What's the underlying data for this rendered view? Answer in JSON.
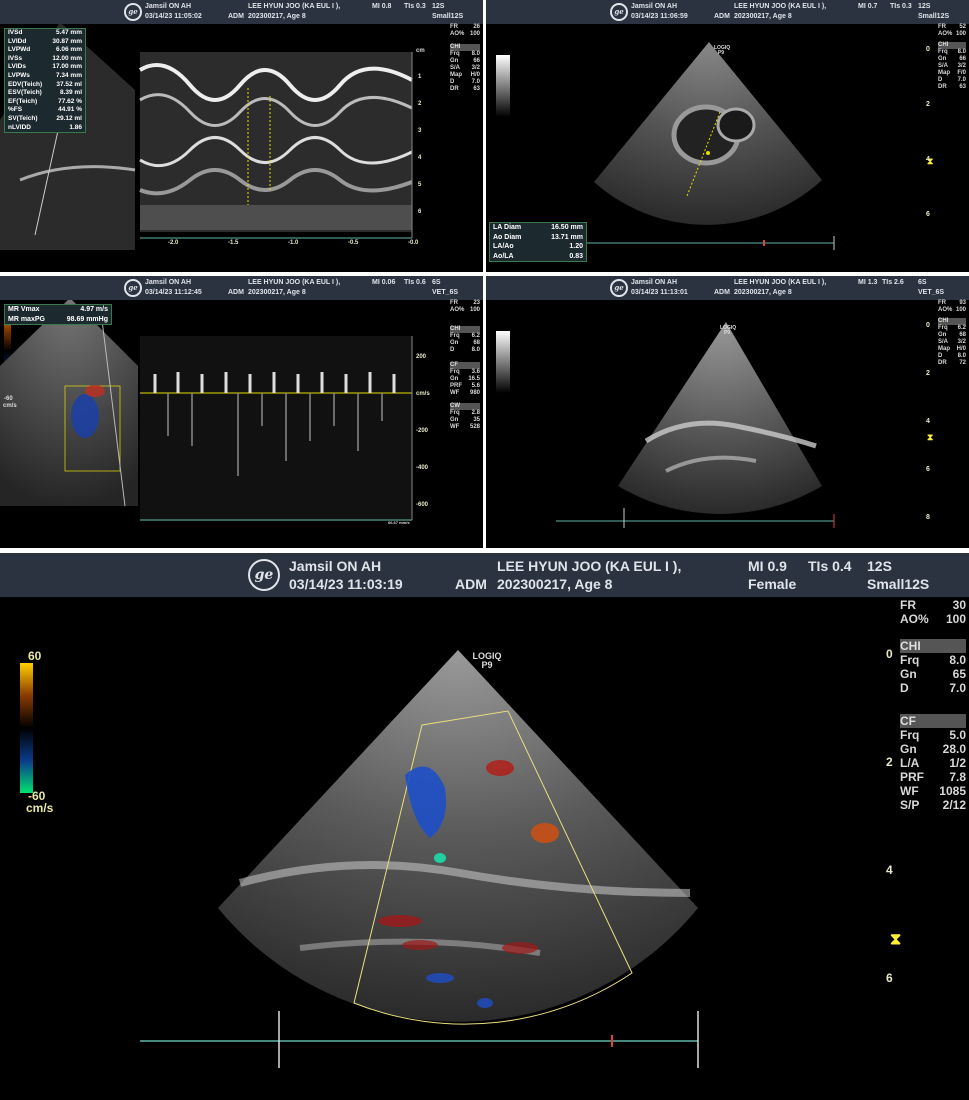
{
  "panel_tl": {
    "header": {
      "site": "Jamsil ON AH",
      "datetime": "03/14/23 11:05:02",
      "adm": "ADM",
      "patient": "LEE HYUN JOO (KA EUL I ),",
      "id_age": "202300217, Age 8",
      "mi": "MI 0.8",
      "tis": "TIs 0.3",
      "probe": "12S",
      "preset": "Small12S"
    },
    "side": [
      {
        "k": "FR",
        "v": "26"
      },
      {
        "k": "AO%",
        "v": "100"
      }
    ],
    "chi_title": "CHI",
    "chi": [
      {
        "k": "Frq",
        "v": "8.0"
      },
      {
        "k": "Gn",
        "v": "66"
      },
      {
        "k": "S/A",
        "v": "3/2"
      },
      {
        "k": "Map",
        "v": "H/0"
      },
      {
        "k": "D",
        "v": "7.0"
      },
      {
        "k": "DR",
        "v": "63"
      }
    ],
    "meas": [
      {
        "k": "IVSd",
        "v": "5.47 mm"
      },
      {
        "k": "LVIDd",
        "v": "30.87 mm"
      },
      {
        "k": "LVPWd",
        "v": "6.06 mm"
      },
      {
        "k": "IVSs",
        "v": "12.00 mm"
      },
      {
        "k": "LVIDs",
        "v": "17.00 mm"
      },
      {
        "k": "LVPWs",
        "v": "7.34 mm"
      },
      {
        "k": "EDV(Teich)",
        "v": "37.52 ml"
      },
      {
        "k": "ESV(Teich)",
        "v": "8.39 ml"
      },
      {
        "k": "EF(Teich)",
        "v": "77.62 %"
      },
      {
        "k": "%FS",
        "v": "44.91 %"
      },
      {
        "k": "SV(Teich)",
        "v": "29.12 ml"
      },
      {
        "k": "nLVIDD",
        "v": "1.86"
      }
    ],
    "depth_unit": "cm",
    "depth_ticks": [
      "1",
      "2",
      "3",
      "4",
      "5",
      "6"
    ],
    "time_ticks": [
      "-2.0",
      "-1.5",
      "-1.0",
      "-0.5",
      "-0.0"
    ]
  },
  "panel_tr": {
    "header": {
      "site": "Jamsil ON AH",
      "datetime": "03/14/23 11:06:59",
      "adm": "ADM",
      "patient": "LEE HYUN JOO (KA EUL I ),",
      "id_age": "202300217, Age 8",
      "mi": "MI 0.7",
      "tis": "TIs 0.3",
      "probe": "12S",
      "preset": "Small12S"
    },
    "side": [
      {
        "k": "FR",
        "v": "52"
      },
      {
        "k": "AO%",
        "v": "100"
      }
    ],
    "chi_title": "CHI",
    "chi": [
      {
        "k": "Frq",
        "v": "8.0"
      },
      {
        "k": "Gn",
        "v": "66"
      },
      {
        "k": "S/A",
        "v": "3/2"
      },
      {
        "k": "Map",
        "v": "F/0"
      },
      {
        "k": "D",
        "v": "7.0"
      },
      {
        "k": "DR",
        "v": "63"
      }
    ],
    "logo_text": "LOGIQ P9",
    "meas": [
      {
        "k": "LA Diam",
        "v": "16.50 mm"
      },
      {
        "k": "Ao Diam",
        "v": "13.71 mm"
      },
      {
        "k": "LA/Ao",
        "v": "1.20"
      },
      {
        "k": "Ao/LA",
        "v": "0.83"
      }
    ],
    "depth_ticks": [
      "0",
      "2",
      "4",
      "6"
    ]
  },
  "panel_ml": {
    "header": {
      "site": "Jamsil ON AH",
      "datetime": "03/14/23 11:12:45",
      "adm": "ADM",
      "patient": "LEE HYUN JOO (KA EUL I ),",
      "id_age": "202300217, Age 8",
      "mi": "MI 0.06",
      "tis": "TIs 0.6",
      "probe": "6S",
      "preset": "VET_6S"
    },
    "side": [
      {
        "k": "FR",
        "v": "23"
      },
      {
        "k": "AO%",
        "v": "100"
      }
    ],
    "chi_title": "CHI",
    "chi": [
      {
        "k": "Frq",
        "v": "6.2"
      },
      {
        "k": "Gn",
        "v": "68"
      },
      {
        "k": "D",
        "v": "8.0"
      }
    ],
    "cf_title": "CF",
    "cf": [
      {
        "k": "Frq",
        "v": "3.6"
      },
      {
        "k": "Gn",
        "v": "16.5"
      },
      {
        "k": "PRF",
        "v": "5.6"
      },
      {
        "k": "WF",
        "v": "980"
      }
    ],
    "cw_title": "CW",
    "cw": [
      {
        "k": "Frq",
        "v": "2.8"
      },
      {
        "k": "Gn",
        "v": "35"
      },
      {
        "k": "WF",
        "v": "528"
      }
    ],
    "meas": [
      {
        "k": "MR Vmax",
        "v": "4.97 m/s"
      },
      {
        "k": "MR maxPG",
        "v": "98.69 mmHg"
      }
    ],
    "scale_bottom": "-60",
    "scale_unit": "cm/s",
    "vel_ticks": [
      "200",
      "cm/s",
      "-200",
      "-400",
      "-600"
    ],
    "sweep_label": "66.67 mm/s"
  },
  "panel_mr": {
    "header": {
      "site": "Jamsil ON AH",
      "datetime": "03/14/23 11:13:01",
      "adm": "ADM",
      "patient": "LEE HYUN JOO (KA EUL I ),",
      "id_age": "202300217, Age 8",
      "mi": "MI 1.3",
      "tis": "TIs 2.6",
      "probe": "6S",
      "preset": "VET_6S"
    },
    "side": [
      {
        "k": "FR",
        "v": "93"
      },
      {
        "k": "AO%",
        "v": "100"
      }
    ],
    "chi_title": "CHI",
    "chi": [
      {
        "k": "Frq",
        "v": "6.2"
      },
      {
        "k": "Gn",
        "v": "68"
      },
      {
        "k": "S/A",
        "v": "3/2"
      },
      {
        "k": "Map",
        "v": "H/0"
      },
      {
        "k": "D",
        "v": "8.0"
      },
      {
        "k": "DR",
        "v": "72"
      }
    ],
    "logo_text": "LOGIQ P9",
    "depth_ticks": [
      "0",
      "2",
      "4",
      "6",
      "8"
    ]
  },
  "panel_bottom": {
    "header": {
      "site": "Jamsil ON AH",
      "datetime": "03/14/23 11:03:19",
      "adm": "ADM",
      "patient": "LEE HYUN JOO (KA EUL I ),",
      "id_age": "202300217, Age 8",
      "mi": "MI 0.9",
      "tis": "TIs 0.4",
      "probe": "12S",
      "preset": "Small12S"
    },
    "side": [
      {
        "k": "FR",
        "v": "30"
      },
      {
        "k": "AO%",
        "v": "100"
      }
    ],
    "chi_title": "CHI",
    "chi": [
      {
        "k": "Frq",
        "v": "8.0"
      },
      {
        "k": "Gn",
        "v": "65"
      },
      {
        "k": "D",
        "v": "7.0"
      }
    ],
    "cf_title": "CF",
    "cf": [
      {
        "k": "Frq",
        "v": "5.0"
      },
      {
        "k": "Gn",
        "v": "28.0"
      },
      {
        "k": "L/A",
        "v": "1/2"
      },
      {
        "k": "PRF",
        "v": "7.8"
      },
      {
        "k": "WF",
        "v": "1085"
      },
      {
        "k": "S/P",
        "v": "2/12"
      }
    ],
    "logo_text": "LOGIQ P9",
    "scale_top": "60",
    "scale_bottom": "-60",
    "scale_unit": "cm/s",
    "depth_ticks": [
      "0",
      "2",
      "4",
      "6"
    ]
  },
  "colors": {
    "header_bg": "#2b3340",
    "panel_bg": "#000000",
    "meas_border": "#3a7a4a",
    "caliper": "#e5e000",
    "baseline": "#5fb6a8"
  }
}
